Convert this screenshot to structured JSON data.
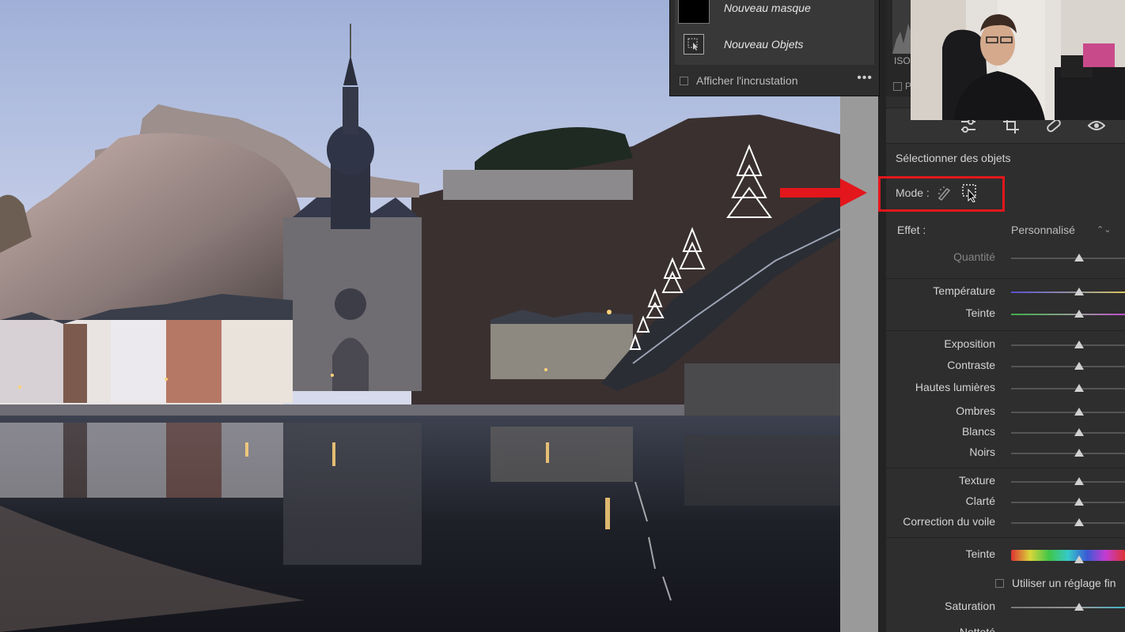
{
  "masks_popup": {
    "items": [
      {
        "label": "Nouveau masque",
        "thumb": "black-mask-thumbnail"
      },
      {
        "label": "Nouveau Objets",
        "thumb": "object-select-icon"
      }
    ],
    "overlay_label": "Afficher l'incrustation",
    "overlay_checked": false,
    "menu_glyph": "•••"
  },
  "panel": {
    "iso_label": "ISO",
    "histo_check_label": "P",
    "tools": [
      "adjust-sliders-icon",
      "crop-icon",
      "heal-bandage-icon",
      "red-eye-icon"
    ],
    "section_title": "Sélectionner des objets",
    "mode_label": "Mode :",
    "mode_icons": [
      "brush-select-icon",
      "rectangle-select-icon"
    ],
    "effect_label": "Effet :",
    "effect_value": "Personnalisé",
    "effect_caret": "⌃⌄",
    "sliders": [
      {
        "label": "Quantité",
        "value": 0.6,
        "dim": true
      },
      {
        "label": "Température",
        "value": 0.6
      },
      {
        "label": "Teinte",
        "value": 0.6
      },
      {
        "label": "Exposition",
        "value": 0.6
      },
      {
        "label": "Contraste",
        "value": 0.6
      },
      {
        "label": "Hautes lumières",
        "value": 0.6
      },
      {
        "label": "Ombres",
        "value": 0.6
      },
      {
        "label": "Blancs",
        "value": 0.6
      },
      {
        "label": "Noirs",
        "value": 0.6
      },
      {
        "label": "Texture",
        "value": 0.6
      },
      {
        "label": "Clarté",
        "value": 0.6
      },
      {
        "label": "Correction du voile",
        "value": 0.6
      },
      {
        "label": "Teinte",
        "value": 0.6
      },
      {
        "label": "Saturation",
        "value": 0.6
      }
    ],
    "finetune_label": "Utiliser un réglage fin",
    "partial_label": "Netteté"
  },
  "colors": {
    "highlight": "#e3161c",
    "arrow": "#e3161c",
    "panel_bg": "#2e2e2e"
  }
}
